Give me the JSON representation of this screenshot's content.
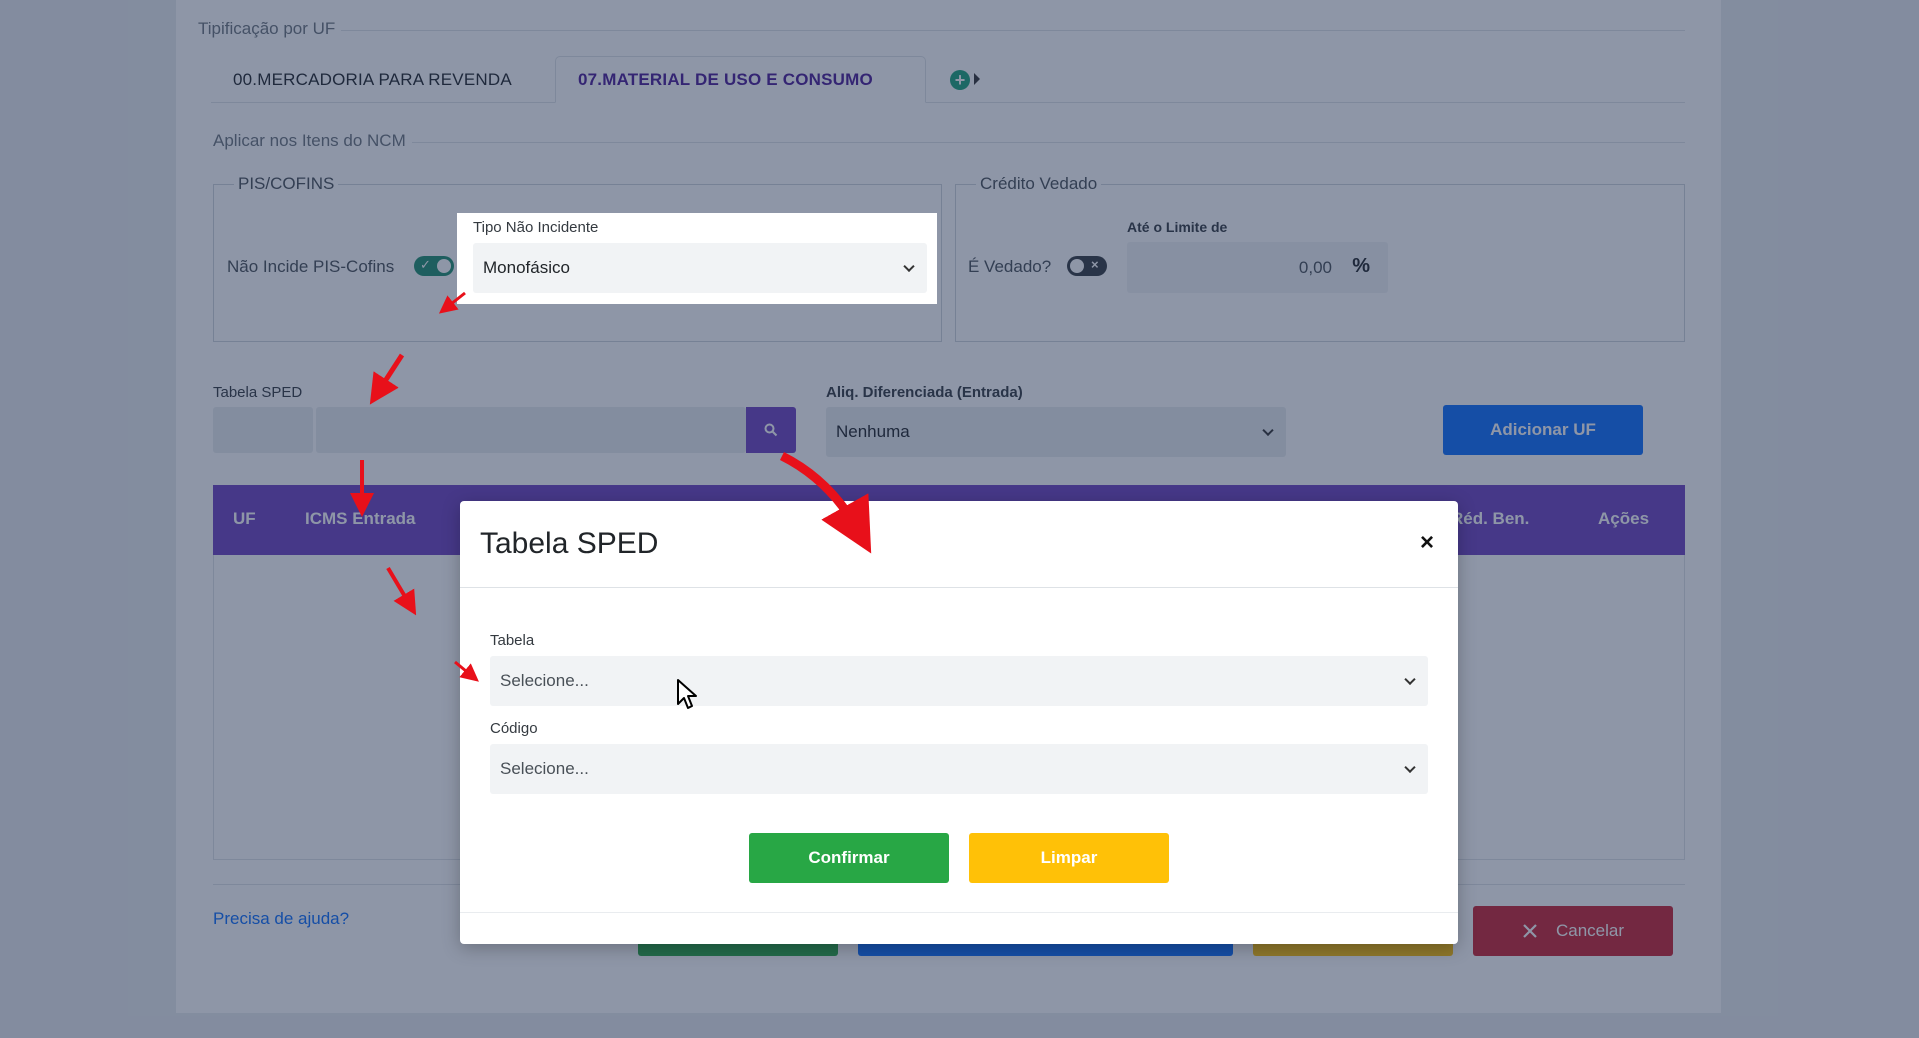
{
  "page": {
    "fieldset_title": "Tipificação por UF",
    "tabs": [
      {
        "label": "00.MERCADORIA PARA REVENDA"
      },
      {
        "label": "07.MATERIAL DE USO E CONSUMO"
      }
    ],
    "apply_section": "Aplicar nos Itens do NCM",
    "pis": {
      "legend": "PIS/COFINS",
      "toggle_label": "Não Incide PIS-Cofins",
      "tipo_label": "Tipo Não Incidente",
      "tipo_value": "Monofásico"
    },
    "credito": {
      "legend": "Crédito Vedado",
      "toggle_label": "É Vedado?",
      "limite_label": "Até o Limite de",
      "limite_value": "0,00",
      "percent_symbol": "%"
    },
    "sped": {
      "label": "Tabela SPED"
    },
    "aliq": {
      "label": "Aliq. Diferenciada (Entrada)",
      "value": "Nenhuma"
    },
    "add_uf_button": "Adicionar UF",
    "table_headers": {
      "uf": "UF",
      "icms_entrada": "ICMS Entrada",
      "red_ben": "Réd. Ben.",
      "acoes": "Ações"
    },
    "help_link": "Precisa de ajuda?",
    "cancel_button": "Cancelar",
    "cancel_icon": "close-icon"
  },
  "modal": {
    "title": "Tabela SPED",
    "close_icon": "close-icon",
    "tabela_label": "Tabela",
    "tabela_placeholder": "Selecione...",
    "codigo_label": "Código",
    "codigo_placeholder": "Selecione...",
    "confirm_button": "Confirmar",
    "clear_button": "Limpar"
  },
  "colors": {
    "purple": "#6f42c1",
    "blue": "#0d6efd",
    "green": "#28a745",
    "yellow": "#ffc107",
    "red": "#c82333",
    "arrow_red": "#e8101a"
  }
}
